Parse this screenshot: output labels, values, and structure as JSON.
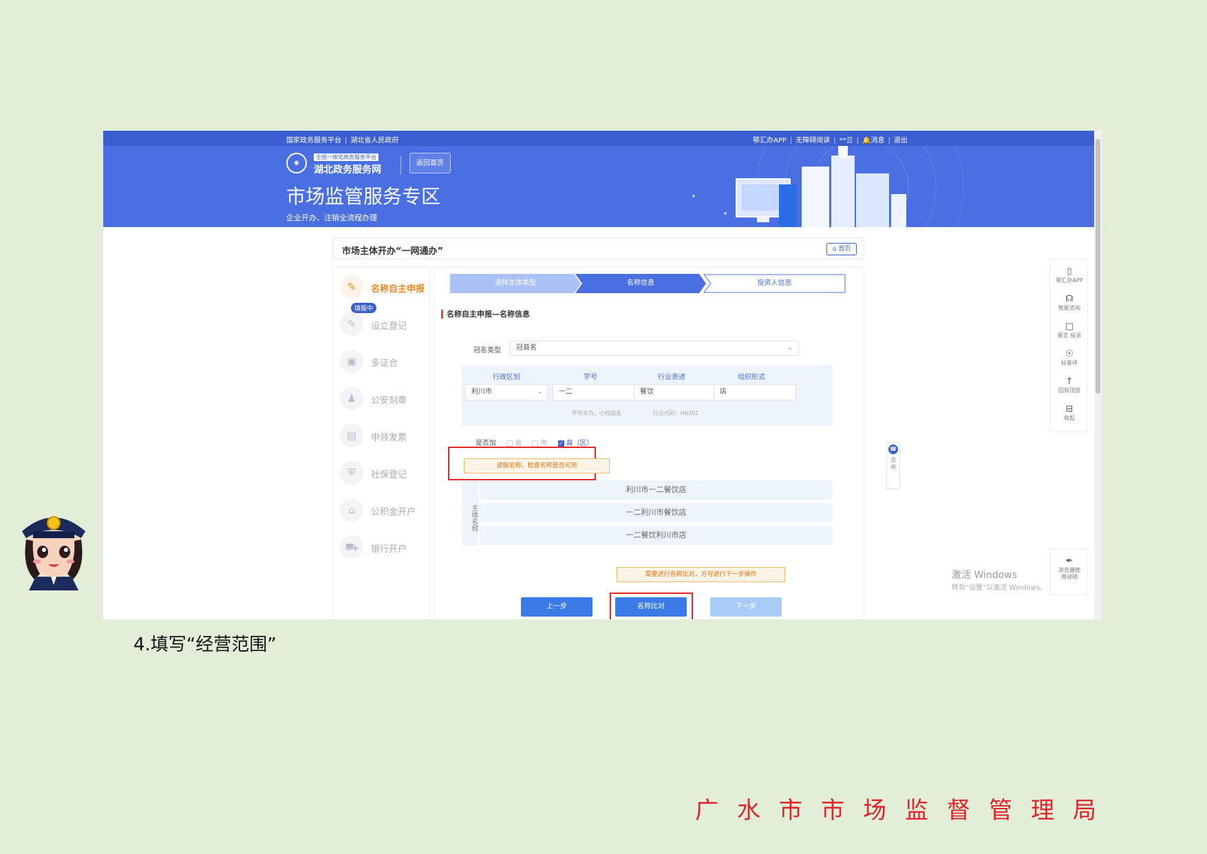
{
  "topbar": {
    "left_links": [
      "国家政务服务平台",
      "湖北省人民政府"
    ],
    "right_links": [
      "鄂汇办APP",
      "无障碍阅读",
      "**兰",
      "消息",
      "退出"
    ]
  },
  "banner": {
    "logo_tag": "全国一体化政务服务平台",
    "logo_name": "湖北政务服务网",
    "back_home": "返回首页",
    "title": "市场监管服务专区",
    "subtitle": "企业开办、注销全流程办理"
  },
  "page": {
    "title": "市场主体开办“一网通办”",
    "home_button": "首页"
  },
  "sidebar": {
    "badge": "填报中",
    "items": [
      {
        "label": "名称自主申报",
        "icon": "edit-icon"
      },
      {
        "label": "设立登记",
        "icon": "register-icon"
      },
      {
        "label": "多证合",
        "icon": "certificate-icon"
      },
      {
        "label": "公安刻章",
        "icon": "stamp-icon"
      },
      {
        "label": "申领发票",
        "icon": "invoice-icon"
      },
      {
        "label": "社保登记",
        "icon": "shield-icon"
      },
      {
        "label": "公积金开户",
        "icon": "house-icon"
      },
      {
        "label": "银行开户",
        "icon": "bank-icon"
      }
    ]
  },
  "steps": [
    "选择主体类型",
    "名称信息",
    "投资人信息"
  ],
  "form": {
    "section_title": "名称自主申报—名称信息",
    "name_type_label": "冠名类型",
    "name_type_value": "冠县名",
    "columns": [
      "行政区划",
      "字号",
      "行业表述",
      "组织形式"
    ],
    "values": [
      "利川市",
      "一二",
      "餐饮",
      "店"
    ],
    "hints": [
      "字号多为，小校超名",
      "行业代码：H6201"
    ],
    "checkbox_label": "是否加",
    "checkbox_options": [
      "省",
      "市",
      "县（区）"
    ],
    "tip": "请核名称，检查名称是否可用",
    "result_side_label": "主体名称",
    "results": [
      "利川市一二餐饮店",
      "一二利川市餐饮店",
      "一二餐饮利川市店"
    ],
    "tip2": "需要进行名称比对，方可进行下一步操作",
    "buttons": {
      "prev": "上一步",
      "compare": "名称比对",
      "next": "下一步"
    }
  },
  "float_bar": {
    "items": [
      {
        "label": "鄂汇办APP",
        "icon": "phone-icon"
      },
      {
        "label": "智能咨询",
        "icon": "headset-icon"
      },
      {
        "label": "留言 投诉",
        "icon": "message-icon"
      },
      {
        "label": "好差评",
        "icon": "rating-icon"
      },
      {
        "label": "回到顶部",
        "icon": "arrow-up-icon"
      },
      {
        "label": "收起",
        "icon": "collapse-icon"
      }
    ],
    "bottom_label": "浏览器使用说明"
  },
  "mini_tab_label": "咨询",
  "watermark": {
    "line1": "激活 Windows",
    "line2": "转到“设置”以激活 Windows。"
  },
  "caption": "4.填写“经营范围”",
  "footer": "广水市市场监督管理局",
  "colors": {
    "brand_blue": "#4a6fe3",
    "highlight_red": "#e8262a",
    "footer_red": "#e0242a",
    "page_bg": "#e2eed8"
  }
}
